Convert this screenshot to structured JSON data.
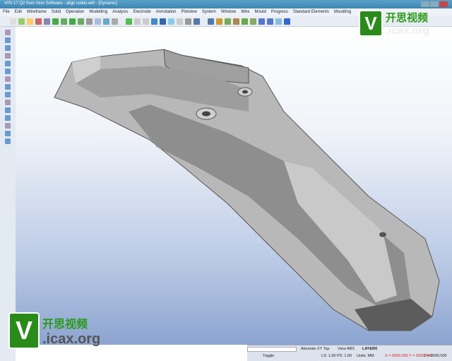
{
  "title": "VISI 17 Q2 from Vero Software - align solids.wkf - [Dynamic]",
  "menu": [
    "File",
    "Edit",
    "Wireframe",
    "Solid",
    "Operation",
    "Modelling",
    "Analysis",
    "Electrode",
    "Annotation",
    "Plotview",
    "System",
    "Window",
    "Wire",
    "Mould",
    "Progress",
    "Standard Elements",
    "Moulding"
  ],
  "status": {
    "view_mode": "Absolute XY Top",
    "view": "View ABS",
    "layer": "LAYER0",
    "toggle": "Toggle",
    "scale": "LS: 1.00 PS: 1.00",
    "units": "Units: MM",
    "coords": "X = 0000.000 Y = 0000.000",
    "z": "Z = 0000.000"
  },
  "watermark": {
    "logo": "V",
    "cn": "开思视频",
    "url": ".icax.org"
  }
}
